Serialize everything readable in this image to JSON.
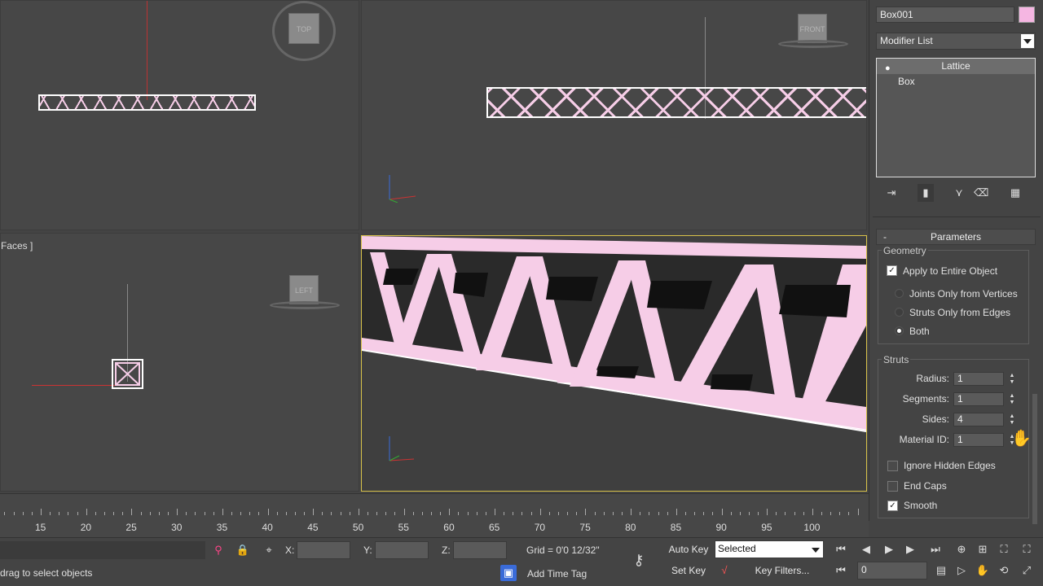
{
  "viewports": {
    "left_label": "Faces ]",
    "top_cube": "TOP",
    "front_cube": "FRONT",
    "left_cube": "LEFT"
  },
  "panel": {
    "object_name": "Box001",
    "object_color": "#f5b6e2",
    "modifier_list": "Modifier List",
    "stack": [
      "Lattice",
      "Box"
    ],
    "rollout_title": "Parameters",
    "rollout_collapse": "-",
    "geometry": {
      "group": "Geometry",
      "apply_entire": "Apply to Entire Object",
      "apply_checked": true,
      "options": [
        "Joints Only from Vertices",
        "Struts Only from Edges",
        "Both"
      ],
      "selected_option": "Both"
    },
    "struts": {
      "group": "Struts",
      "radius_label": "Radius:",
      "radius_value": "1",
      "segments_label": "Segments:",
      "segments_value": "1",
      "sides_label": "Sides:",
      "sides_value": "4",
      "matid_label": "Material ID:",
      "matid_value": "1",
      "ignore_hidden": "Ignore Hidden Edges",
      "end_caps": "End Caps",
      "smooth": "Smooth"
    }
  },
  "timeline": {
    "ticks": [
      "15",
      "20",
      "25",
      "30",
      "35",
      "40",
      "45",
      "50",
      "55",
      "60",
      "65",
      "70",
      "75",
      "80",
      "85",
      "90",
      "95",
      "100"
    ]
  },
  "status": {
    "prompt": "drag to select objects",
    "x_label": "X:",
    "y_label": "Y:",
    "z_label": "Z:",
    "grid": "Grid = 0'0 12/32\"",
    "add_time_tag": "Add Time Tag",
    "auto_key": "Auto Key",
    "selected": "Selected",
    "set_key": "Set Key",
    "key_filters": "Key Filters...",
    "frame": "0"
  },
  "colors": {
    "accent_active_viewport": "#d8c24a",
    "truss_pink": "#f6cde7"
  }
}
